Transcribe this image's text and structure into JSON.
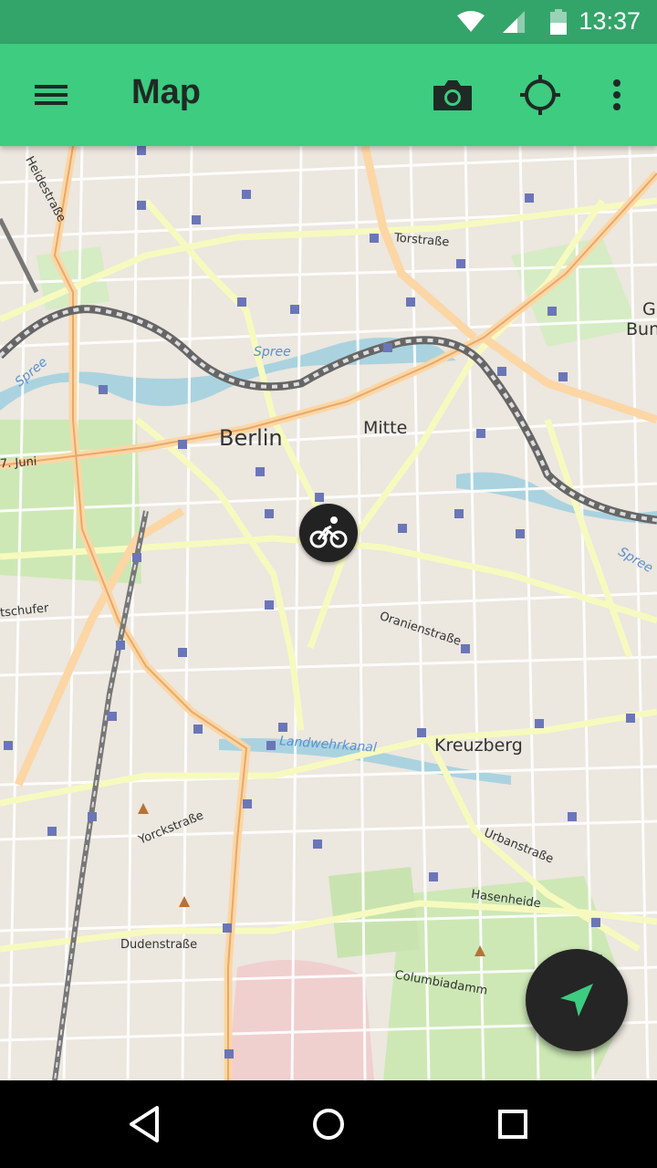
{
  "status_bar": {
    "time": "13:37",
    "icons": [
      "wifi-icon",
      "cell-signal-icon",
      "battery-icon"
    ]
  },
  "app_bar": {
    "title": "Map",
    "icons": [
      "menu-icon",
      "camera-icon",
      "locate-icon",
      "more-vert-icon"
    ],
    "color": "#3dcc80",
    "status_color": "#34a56a"
  },
  "map": {
    "labels": {
      "berlin": "Berlin",
      "mitte": "Mitte",
      "kreuzberg": "Kreuzberg",
      "torstrasse": "Torstraße",
      "oranienstrasse": "Oranienstraße",
      "landwehrkanal": "Landwehrkanal",
      "yorckstrasse": "Yorckstraße",
      "urbanstrasse": "Urbanstraße",
      "hasenheide": "Hasenheide",
      "dudenstrasse": "Dudenstraße",
      "columbiadamm": "Columbiadamm",
      "spree": "Spree",
      "spree_left": "Spree",
      "spree_right": "Spree",
      "juni": "7. Juni",
      "schufer": "tschufer",
      "heidestrasse": "Heidestraße",
      "bun": "Bun",
      "g": "G"
    },
    "marker_icon": "bicycle-icon"
  },
  "fab": {
    "icon": "navigation-arrow-icon",
    "accent": "#3dcc80"
  },
  "nav_bar": {
    "icons": [
      "back-icon",
      "home-icon",
      "recents-icon"
    ]
  }
}
